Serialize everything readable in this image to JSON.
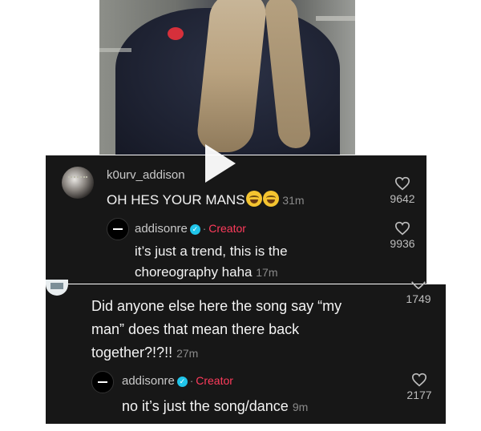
{
  "comment1": {
    "username": "k0urv_addison",
    "text": "OH HES YOUR MANS",
    "emojis": [
      "face-with-tears-of-joy",
      "face-with-tears-of-joy"
    ],
    "time": "31m",
    "likes": "9642",
    "reply": {
      "username": "addisonre",
      "creator_label": "Creator",
      "separator": "·",
      "text_line1": "it’s just a trend, this is the",
      "text_line2": "choreography haha",
      "time": "17m",
      "likes": "9936"
    }
  },
  "comment2": {
    "text_line1": "Did anyone else here the song say “my",
    "text_line2": "man” does that mean there back",
    "text_line3": "together?!?!!",
    "time": "27m",
    "likes": "1749",
    "reply": {
      "username": "addisonre",
      "creator_label": "Creator",
      "separator": "·",
      "text": "no it’s just the song/dance",
      "time": "9m",
      "likes": "2177"
    }
  },
  "icons": {
    "like": "heart-outline-icon",
    "verified": "verified-badge-icon",
    "play": "play-icon"
  },
  "colors": {
    "panel_bg": "#171717",
    "creator": "#ff3b5c",
    "verified": "#20c5ea",
    "muted": "#8a8a8a"
  }
}
